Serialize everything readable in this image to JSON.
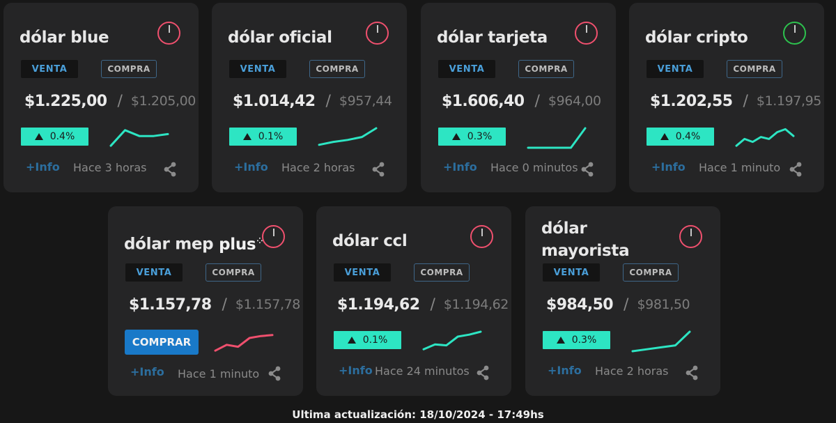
{
  "labels": {
    "venta": "VENTA",
    "compra": "COMPRA",
    "info": "+Info",
    "comprar": "COMPRAR"
  },
  "cards": [
    {
      "title": "dólar blue",
      "venta": "$1.225,00",
      "compra": "$1.205,00",
      "change": "0.4%",
      "updated": "Hace 3 horas",
      "clock": "red",
      "trend": [
        0.1,
        0.9,
        0.6,
        0.6,
        0.7
      ]
    },
    {
      "title": "dólar oficial",
      "venta": "$1.014,42",
      "compra": "$957,44",
      "change": "0.1%",
      "updated": "Hace 2 horas",
      "clock": "red",
      "trend": [
        0.15,
        0.3,
        0.4,
        0.55,
        1.0
      ]
    },
    {
      "title": "dólar tarjeta",
      "venta": "$1.606,40",
      "compra": "$964,00",
      "change": "0.3%",
      "updated": "Hace 0 minutos",
      "clock": "red",
      "trend": [
        0.0,
        0.0,
        0.0,
        0.0,
        1.0
      ]
    },
    {
      "title": "dólar cripto",
      "venta": "$1.202,55",
      "compra": "$1.197,95",
      "change": "0.4%",
      "updated": "Hace 1 minuto",
      "clock": "green",
      "trend": [
        0.1,
        0.45,
        0.3,
        0.55,
        0.45,
        0.8,
        0.95,
        0.6
      ]
    },
    {
      "title": "dólar mep",
      "title_suffix": "plus",
      "venta": "$1.157,78",
      "compra": "$1.157,78",
      "updated": "Hace 1 minuto",
      "clock": "red",
      "buy_button": true,
      "trend": [
        0.1,
        0.4,
        0.3,
        0.75,
        0.85,
        0.9
      ]
    },
    {
      "title": "dólar ccl",
      "venta": "$1.194,62",
      "compra": "$1.194,62",
      "change": "0.1%",
      "updated": "Hace 24 minutos",
      "clock": "red",
      "trend": [
        0.1,
        0.35,
        0.3,
        0.75,
        0.85,
        1.0
      ]
    },
    {
      "title": "dólar mayorista",
      "venta": "$984,50",
      "compra": "$981,50",
      "change": "0.3%",
      "updated": "Hace 2 horas",
      "clock": "red",
      "trend": [
        0.0,
        0.1,
        0.2,
        0.3,
        1.0
      ]
    }
  ],
  "footer": "Ultima actualización: 18/10/2024 - 17:49hs",
  "colors": {
    "background": "#171717",
    "card": "#252526",
    "accent_teal": "#2de5c3",
    "trend_down_red": "#f0506e",
    "clock_green": "#2dc24e",
    "comprar_blue": "#1979c8"
  }
}
